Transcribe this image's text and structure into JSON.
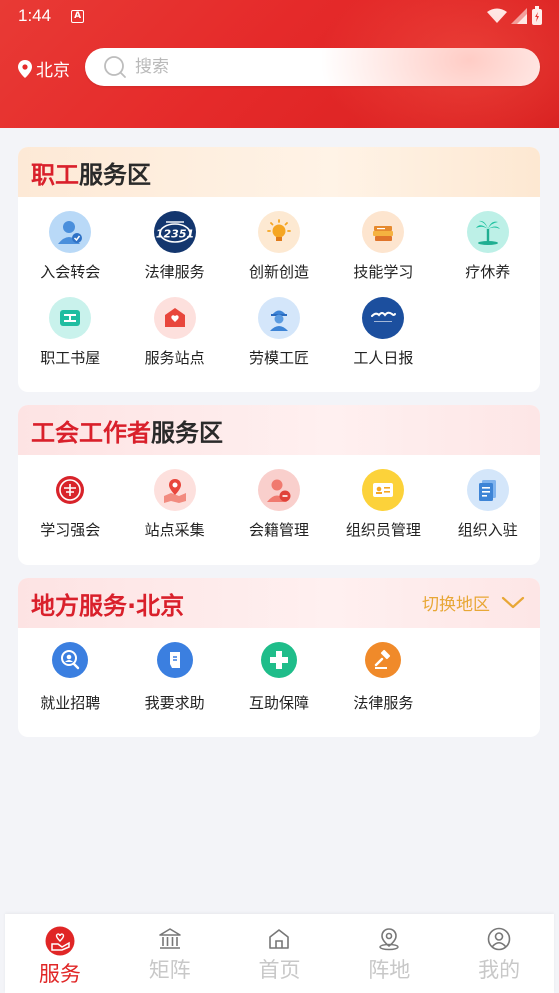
{
  "status": {
    "time": "1:44",
    "notif_letter": "A"
  },
  "location": {
    "city": "北京"
  },
  "search": {
    "placeholder": "搜索"
  },
  "worker_section": {
    "title_red": "职工",
    "title_dark": "服务区",
    "items": [
      {
        "label": "入会转会",
        "icon": "join-icon"
      },
      {
        "label": "法律服务",
        "icon": "hotline-12351-icon"
      },
      {
        "label": "创新创造",
        "icon": "lightbulb-icon"
      },
      {
        "label": "技能学习",
        "icon": "books-icon"
      },
      {
        "label": "疗休养",
        "icon": "palm-tree-icon"
      },
      {
        "label": "职工书屋",
        "icon": "bookhouse-icon"
      },
      {
        "label": "服务站点",
        "icon": "service-station-icon"
      },
      {
        "label": "劳模工匠",
        "icon": "model-worker-icon"
      },
      {
        "label": "工人日报",
        "icon": "workers-daily-icon"
      }
    ]
  },
  "unionist_section": {
    "title_red": "工会工作者",
    "title_dark": "服务区",
    "items": [
      {
        "label": "学习强会",
        "icon": "union-emblem-icon"
      },
      {
        "label": "站点采集",
        "icon": "map-pin-icon"
      },
      {
        "label": "会籍管理",
        "icon": "membership-icon"
      },
      {
        "label": "组织员管理",
        "icon": "id-card-icon"
      },
      {
        "label": "组织入驻",
        "icon": "documents-icon"
      }
    ]
  },
  "local_section": {
    "title": "地方服务·北京",
    "switch_label": "切换地区",
    "items": [
      {
        "label": "就业招聘",
        "icon": "job-search-icon"
      },
      {
        "label": "我要求助",
        "icon": "help-hand-icon"
      },
      {
        "label": "互助保障",
        "icon": "medical-cross-icon"
      },
      {
        "label": "法律服务",
        "icon": "gavel-icon"
      }
    ]
  },
  "tabbar": {
    "tabs": [
      {
        "label": "服务",
        "icon": "service-icon",
        "active": true
      },
      {
        "label": "矩阵",
        "icon": "bank-icon",
        "active": false
      },
      {
        "label": "首页",
        "icon": "home-icon",
        "active": false
      },
      {
        "label": "阵地",
        "icon": "location-icon",
        "active": false
      },
      {
        "label": "我的",
        "icon": "user-icon",
        "active": false
      }
    ]
  },
  "colors": {
    "brand_red": "#e02626",
    "accent_yellow": "#e8a736"
  }
}
